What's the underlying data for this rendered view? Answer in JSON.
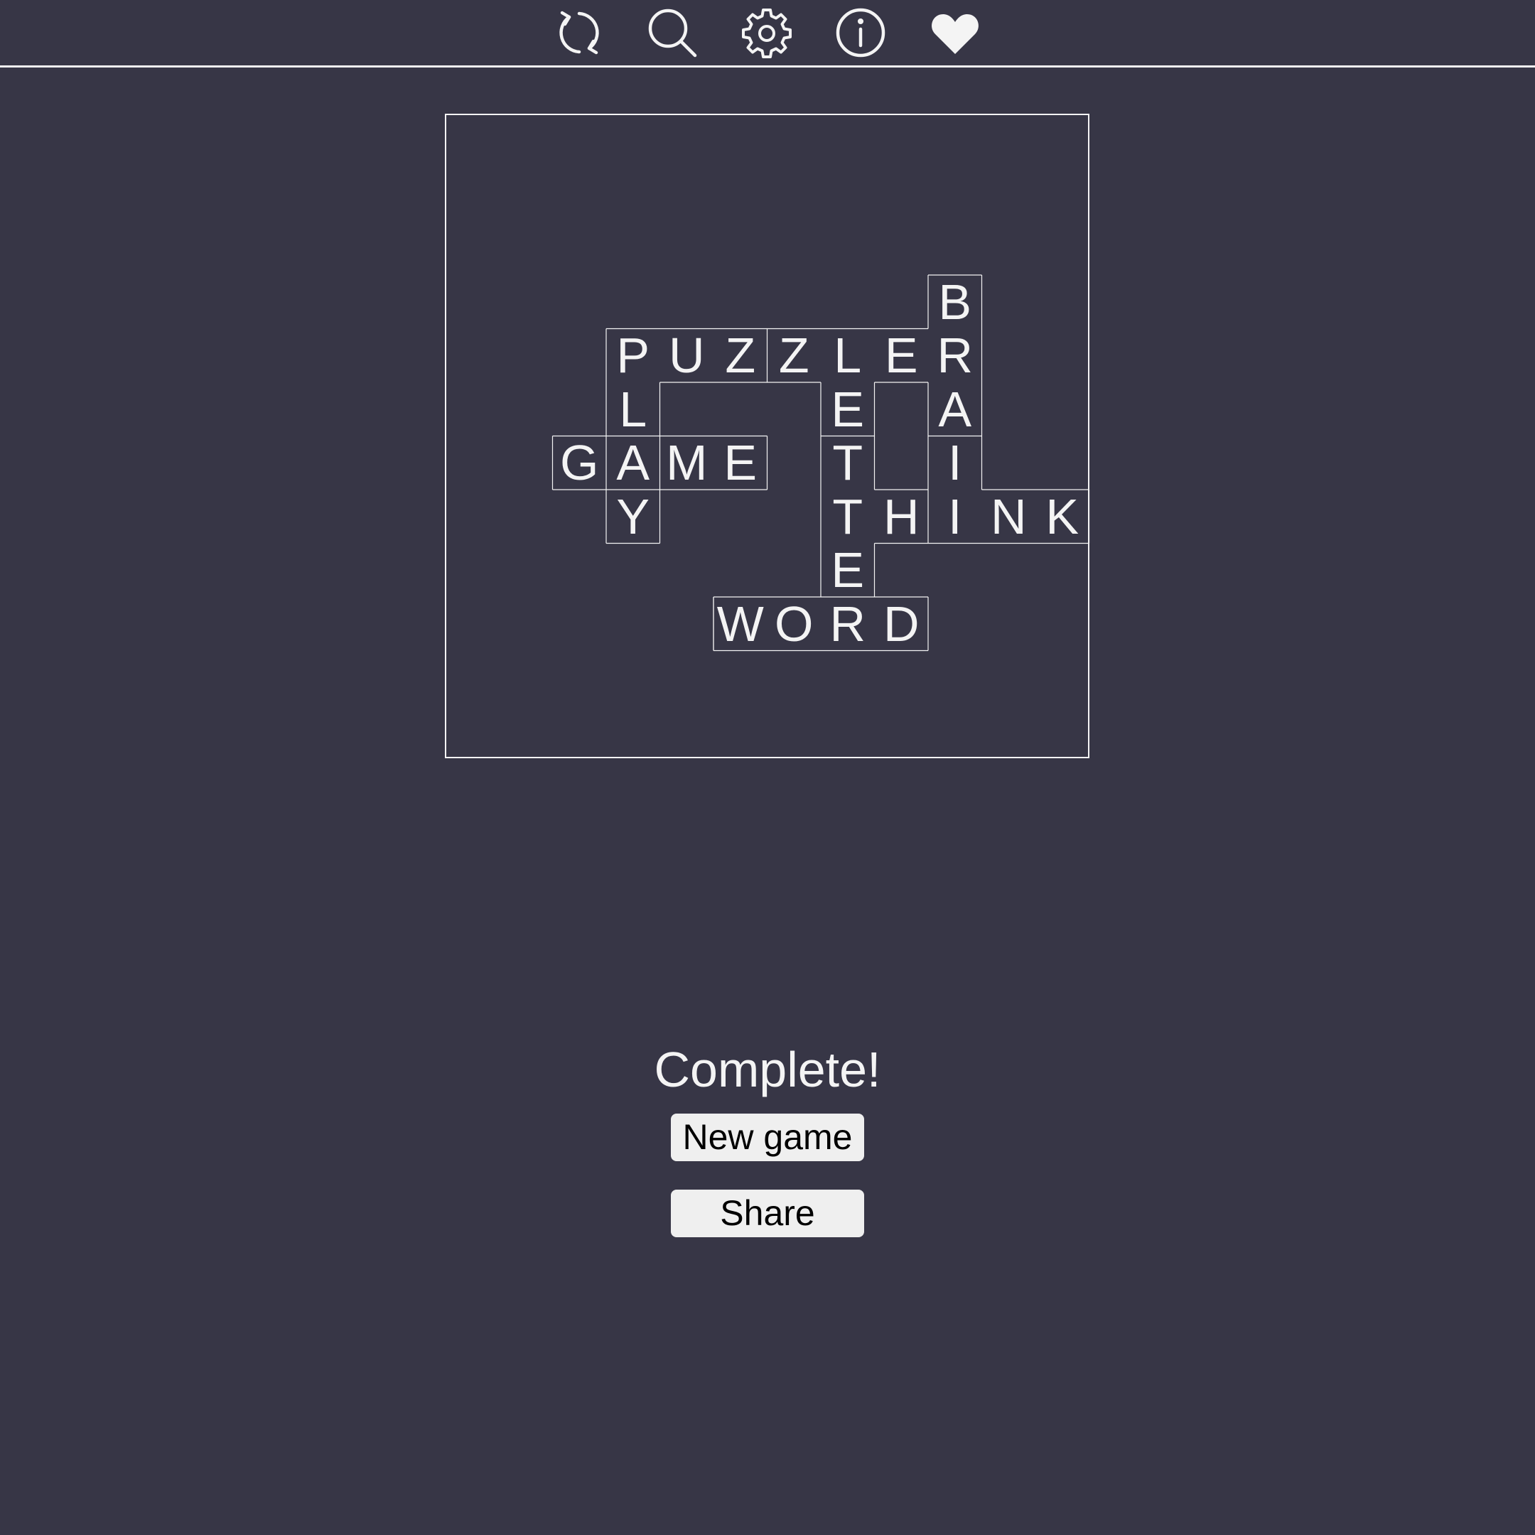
{
  "toolbar": {
    "icons": [
      {
        "name": "refresh-icon"
      },
      {
        "name": "search-icon"
      },
      {
        "name": "gear-icon"
      },
      {
        "name": "info-icon"
      },
      {
        "name": "heart-icon"
      }
    ]
  },
  "board": {
    "cells": [
      {
        "letter": "B",
        "col": 8,
        "row": 2
      },
      {
        "letter": "R",
        "col": 8,
        "row": 3
      },
      {
        "letter": "A",
        "col": 8,
        "row": 4
      },
      {
        "letter": "I",
        "col": 8,
        "row": 5
      },
      {
        "letter": "P",
        "col": 2,
        "row": 3
      },
      {
        "letter": "U",
        "col": 3,
        "row": 3
      },
      {
        "letter": "Z",
        "col": 4,
        "row": 3
      },
      {
        "letter": "Z",
        "col": 5,
        "row": 3
      },
      {
        "letter": "L",
        "col": 6,
        "row": 3
      },
      {
        "letter": "E",
        "col": 7,
        "row": 3
      },
      {
        "letter": "L",
        "col": 2,
        "row": 4
      },
      {
        "letter": "E",
        "col": 6,
        "row": 4
      },
      {
        "letter": "G",
        "col": 1,
        "row": 5
      },
      {
        "letter": "A",
        "col": 2,
        "row": 5
      },
      {
        "letter": "M",
        "col": 3,
        "row": 5
      },
      {
        "letter": "E",
        "col": 4,
        "row": 5
      },
      {
        "letter": "T",
        "col": 6,
        "row": 5
      },
      {
        "letter": "Y",
        "col": 2,
        "row": 6
      },
      {
        "letter": "T",
        "col": 6,
        "row": 6
      },
      {
        "letter": "H",
        "col": 7,
        "row": 6
      },
      {
        "letter": "I",
        "col": 8,
        "row": 6
      },
      {
        "letter": "N",
        "col": 9,
        "row": 6
      },
      {
        "letter": "K",
        "col": 10,
        "row": 6
      },
      {
        "letter": "E",
        "col": 6,
        "row": 7
      },
      {
        "letter": "W",
        "col": 4,
        "row": 8
      },
      {
        "letter": "O",
        "col": 5,
        "row": 8
      },
      {
        "letter": "R",
        "col": 6,
        "row": 8
      },
      {
        "letter": "D",
        "col": 7,
        "row": 8
      }
    ]
  },
  "status": {
    "text": "Complete!"
  },
  "buttons": {
    "new_game": "New game",
    "share": "Share"
  },
  "colors": {
    "background": "#373646",
    "foreground": "#f4f4f4",
    "button_bg": "#efefef"
  }
}
